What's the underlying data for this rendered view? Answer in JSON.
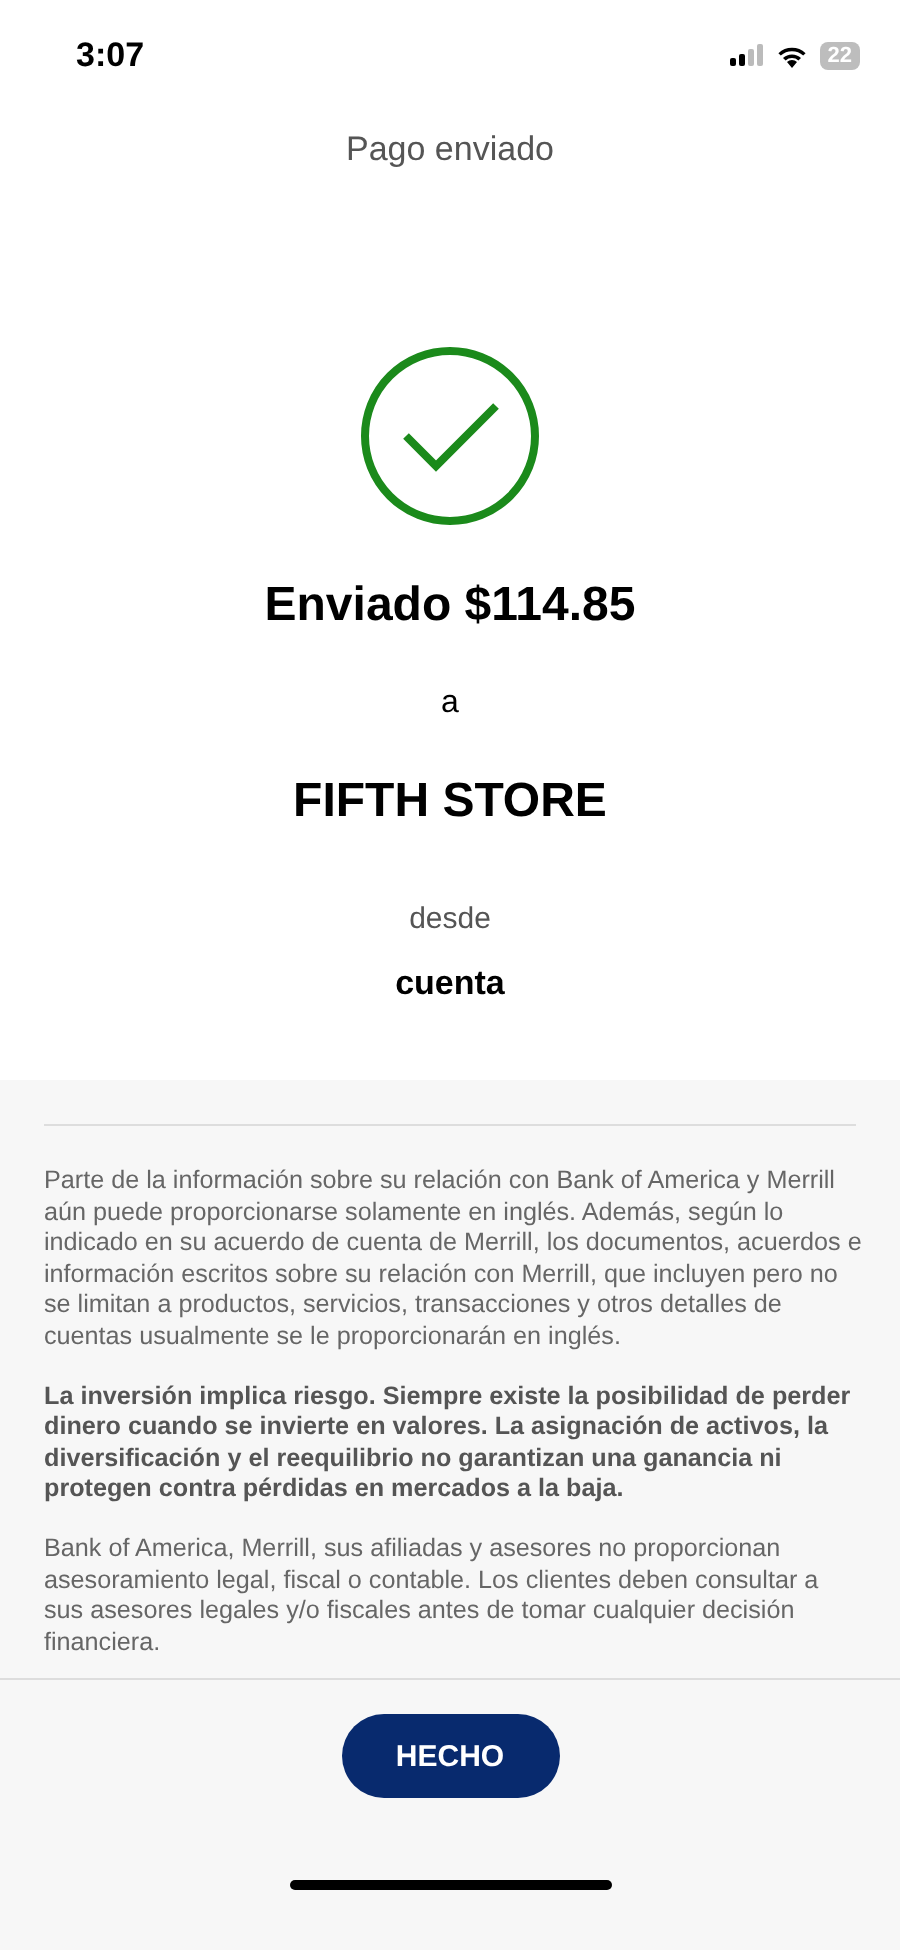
{
  "status_bar": {
    "time": "3:07",
    "battery": "22"
  },
  "header": {
    "title": "Pago enviado"
  },
  "confirmation": {
    "amount": "Enviado $114.85",
    "to_label": "a",
    "recipient": "FIFTH STORE",
    "from_label": "desde",
    "account": "cuenta"
  },
  "disclosures": [
    {
      "text": "Parte de la información sobre su relación con Bank of America y Merrill aún puede proporcionarse solamente en inglés. Además, según lo indicado en su acuerdo de cuenta de Merrill, los documentos, acuerdos e información escritos sobre su relación con Merrill, que incluyen pero no se limitan a productos, servicios, transacciones y otros detalles de cuentas usualmente se le proporcionarán en inglés.",
      "kind": "normal"
    },
    {
      "text": "La inversión implica riesgo. Siempre existe la posibilidad de perder dinero cuando se invierte en valores. La asignación de activos, la diversificación y el reequilibrio no garantizan una ganancia ni protegen contra pérdidas en mercados a la baja.",
      "kind": "bold"
    },
    {
      "text": "Bank of America, Merrill, sus afiliadas y asesores no proporcionan asesoramiento legal, fiscal o contable. Los clientes deben consultar a sus asesores legales y/o fiscales antes de tomar cualquier decisión financiera.",
      "kind": "normal"
    }
  ],
  "done_button": {
    "label": "HECHO"
  }
}
